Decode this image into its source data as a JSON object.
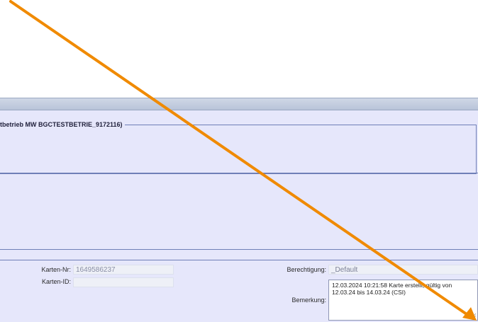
{
  "fieldset": {
    "legend": "tbetrieb MW BGCTESTBETRIE_9172116)"
  },
  "card": {
    "karten_nr_label": "Karten-Nr:",
    "karten_nr_value": "1649586237",
    "karten_id_label": "Karten-ID:",
    "karten_id_value": "",
    "berechtigung_label": "Berechtigung:",
    "berechtigung_value": "_Default",
    "bemerkung_label": "Bemerkung:",
    "bemerkung_value": "12.03.2024 10:21:58 Karte erstellt, gültig von 12.03.24 bis 14.03.24 (CSI)"
  },
  "overlay": {
    "arrow_color": "#F08A00",
    "arrow_icon": "annotation-arrow-icon"
  }
}
